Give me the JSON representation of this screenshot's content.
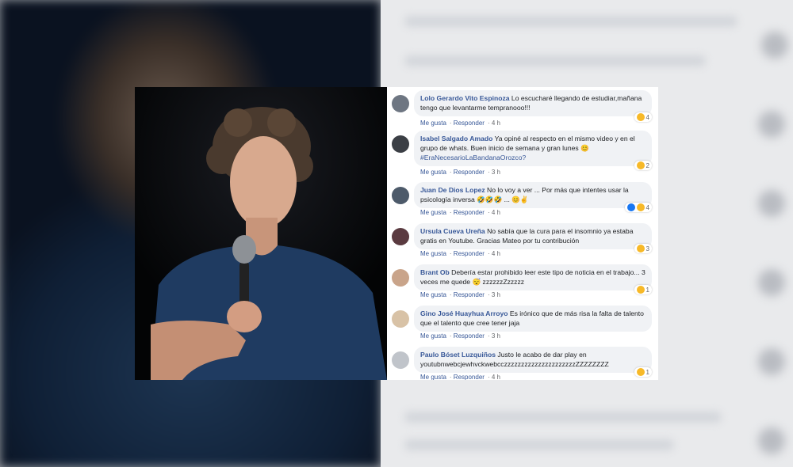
{
  "comments": [
    {
      "author": "Lolo Gerardo Vito Espinoza",
      "text": "Lo escucharé llegando de estudiar,mañana tengo que levantarme tempranooo!!!",
      "hashtag": "",
      "like_label": "Me gusta",
      "reply_label": "Responder",
      "time": "4 h",
      "reactions": "4",
      "reaction_types": [
        "haha"
      ]
    },
    {
      "author": "Isabel Salgado Amado",
      "text": "Ya opiné al respecto en el mismo video y en el grupo de whats. Buen inicio de semana y gran lunes 😊",
      "hashtag": "#EraNecesarioLaBandanaOrozco?",
      "like_label": "Me gusta",
      "reply_label": "Responder",
      "time": "3 h",
      "reactions": "2",
      "reaction_types": [
        "haha"
      ]
    },
    {
      "author": "Juan De Dios Lopez",
      "text": "No lo voy a ver ... Por más que intentes usar la psicología inversa 🤣🤣🤣 ... 😊✌",
      "hashtag": "",
      "like_label": "Me gusta",
      "reply_label": "Responder",
      "time": "4 h",
      "reactions": "4",
      "reaction_types": [
        "like",
        "haha"
      ]
    },
    {
      "author": "Ursula Cueva Ureña",
      "text": "No sabía que la cura para el insomnio ya estaba gratis en Youtube. Gracias Mateo por tu contribución",
      "hashtag": "",
      "like_label": "Me gusta",
      "reply_label": "Responder",
      "time": "4 h",
      "reactions": "3",
      "reaction_types": [
        "haha"
      ]
    },
    {
      "author": "Brant Ob",
      "text": "Debería estar prohibido leer este tipo de noticia en el trabajo... 3 veces me quede 😴 zzzzzzZzzzzz",
      "hashtag": "",
      "like_label": "Me gusta",
      "reply_label": "Responder",
      "time": "3 h",
      "reactions": "1",
      "reaction_types": [
        "haha"
      ]
    },
    {
      "author": "Gino José Huayhua Arroyo",
      "text": "Es irónico que de más risa la falta de talento que el talento que cree tener jaja",
      "hashtag": "",
      "like_label": "Me gusta",
      "reply_label": "Responder",
      "time": "3 h",
      "reactions": "",
      "reaction_types": []
    },
    {
      "author": "Paulo Bóset Luzquiños",
      "text": "Justo le acabo de dar play en youtubnwebcjewhvckwebcczzzzzzzzzzzzzzzzzzzzzZZZZZZZZ",
      "hashtag": "",
      "like_label": "Me gusta",
      "reply_label": "Responder",
      "time": "4 h",
      "reactions": "1",
      "reaction_types": [
        "haha"
      ]
    }
  ],
  "colors": {
    "author": "#385898",
    "bubble": "#f0f2f5",
    "meta": "#65676b",
    "haha": "#f7b928",
    "like": "#1877f2"
  }
}
